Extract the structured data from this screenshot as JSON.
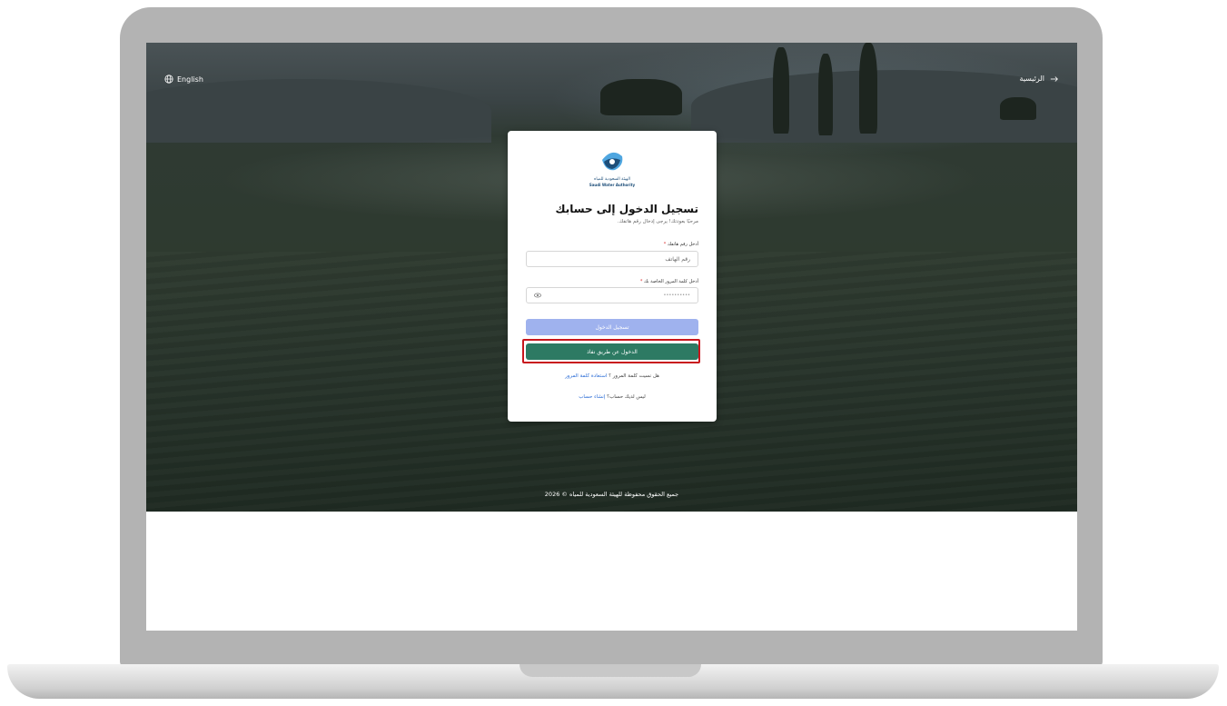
{
  "topbar": {
    "language_label": "English",
    "home_label": "الرئيسية"
  },
  "logo": {
    "org_name_ar": "الهيئة السعودية للمياه",
    "org_name_en": "Saudi Water Authority"
  },
  "login": {
    "title": "تسجيل الدخول إلى حسابك",
    "subtitle": "مرحبًا بعودتك! يرجى إدخال رقم هاتفك.",
    "phone_label": "أدخل رقم هاتفك",
    "phone_placeholder": "رقم الهاتف",
    "password_label": "أدخل كلمة المرور الخاصة بك",
    "password_mask": "••••••••••",
    "required_mark": "*",
    "login_button": "تسجيل الدخول",
    "nafath_button": "الدخول عن طريق نفاذ",
    "forgot_text": "هل نسيت كلمة المرور ؟",
    "forgot_link": "استعادة كلمة المرور",
    "no_account_text": "ليس لديك حساب؟",
    "signup_link": "إنشاء حساب"
  },
  "footer": {
    "copyright": "جميع الحقوق محفوظة للهيئة السعودية للمياه © 2026"
  },
  "colors": {
    "primary_button": "#9fb2ee",
    "nafath_button": "#2d7a63",
    "link": "#2c6dd6",
    "highlight_border": "#c8161d"
  }
}
